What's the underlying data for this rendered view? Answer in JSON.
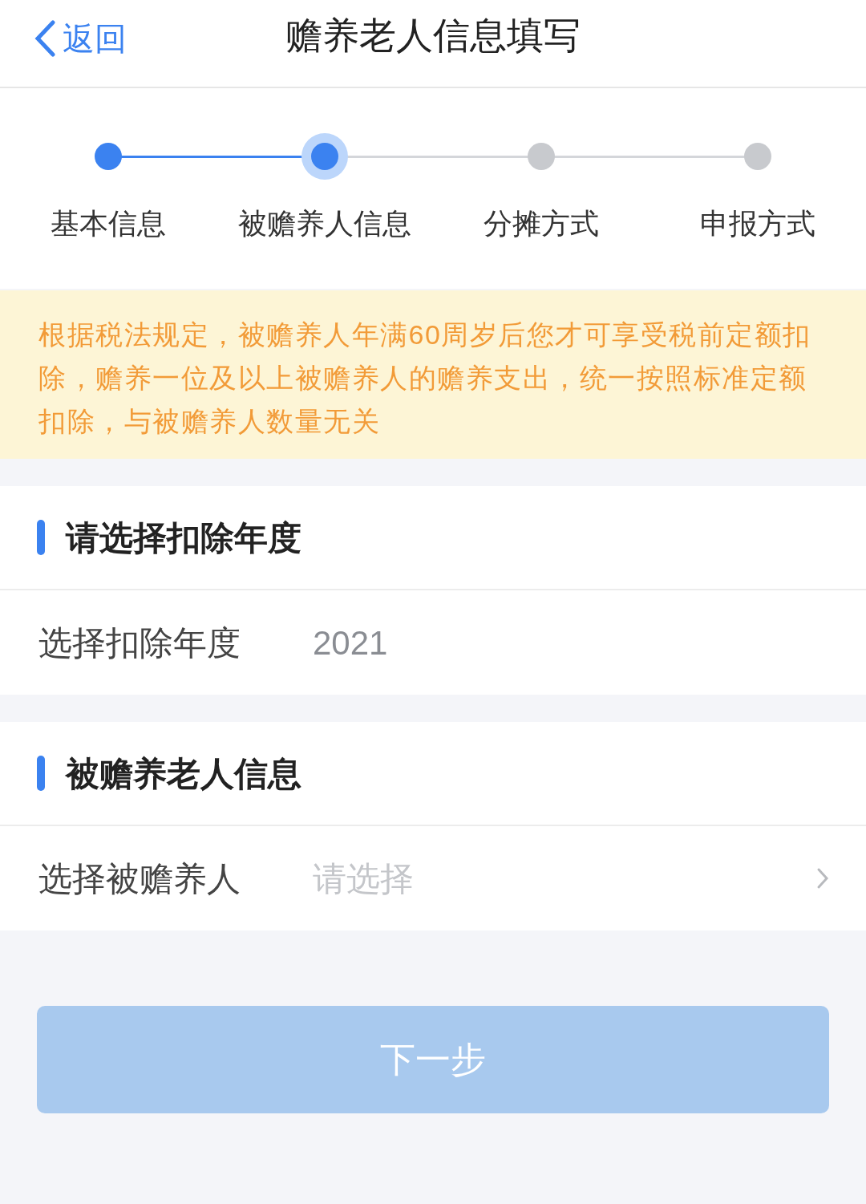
{
  "nav": {
    "back": "返回",
    "title": "赡养老人信息填写"
  },
  "steps": [
    {
      "label": "基本信息",
      "done": true,
      "selected": false
    },
    {
      "label": "被赡养人信息",
      "done": false,
      "selected": true
    },
    {
      "label": "分摊方式",
      "done": false,
      "selected": false
    },
    {
      "label": "申报方式",
      "done": false,
      "selected": false
    }
  ],
  "notice": "根据税法规定，被赡养人年满60周岁后您才可享受税前定额扣除，赡养一位及以上被赡养人的赡养支出，统一按照标准定额扣除，与被赡养人数量无关",
  "sections": [
    {
      "title": "请选择扣除年度",
      "rows": [
        {
          "kind": "value",
          "label": "选择扣除年度",
          "value": "2021"
        }
      ]
    },
    {
      "title": "被赡养老人信息",
      "rows": [
        {
          "kind": "picker",
          "label": "选择被赡养人",
          "placeholder": "请选择"
        }
      ]
    }
  ],
  "next_button": {
    "label": "下一步",
    "disabled": true
  }
}
